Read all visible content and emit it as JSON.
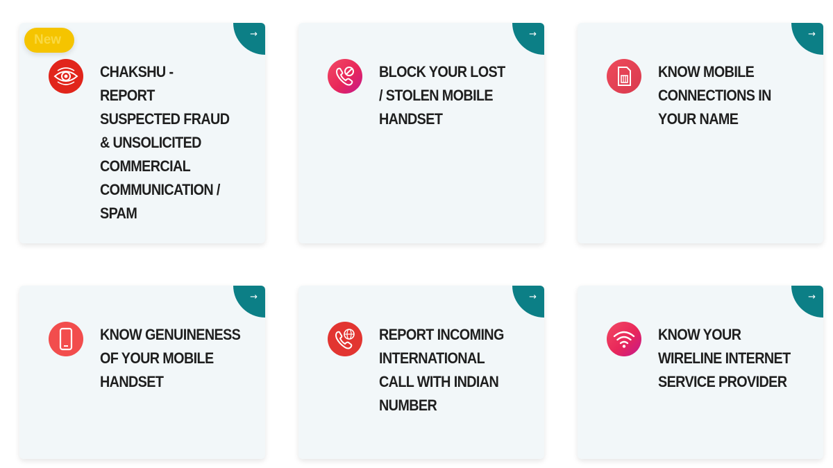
{
  "badge": {
    "label": "New"
  },
  "arrow": "→",
  "cards": [
    {
      "title": "CHAKSHU - REPORT SUSPECTED FRAUD & UNSOLICITED COMMERCIAL COMMUNICATION / SPAM",
      "icon": "eye-icon",
      "color": "#e1251b"
    },
    {
      "title": "BLOCK YOUR LOST / STOLEN MOBILE HANDSET",
      "icon": "blocked-phone-icon",
      "color": "#e8275a"
    },
    {
      "title": "KNOW MOBILE CONNECTIONS IN YOUR NAME",
      "icon": "sim-card-icon",
      "color": "#d93a4e"
    },
    {
      "title": "KNOW GENUINENESS OF YOUR MOBILE HANDSET",
      "icon": "smartphone-icon",
      "color": "#f24d4d"
    },
    {
      "title": "REPORT INCOMING INTERNATIONAL CALL WITH INDIAN NUMBER",
      "icon": "international-call-icon",
      "color": "#e23531"
    },
    {
      "title": "KNOW YOUR WIRELINE INTERNET SERVICE PROVIDER",
      "icon": "wifi-icon",
      "color": "#e8275a"
    }
  ]
}
